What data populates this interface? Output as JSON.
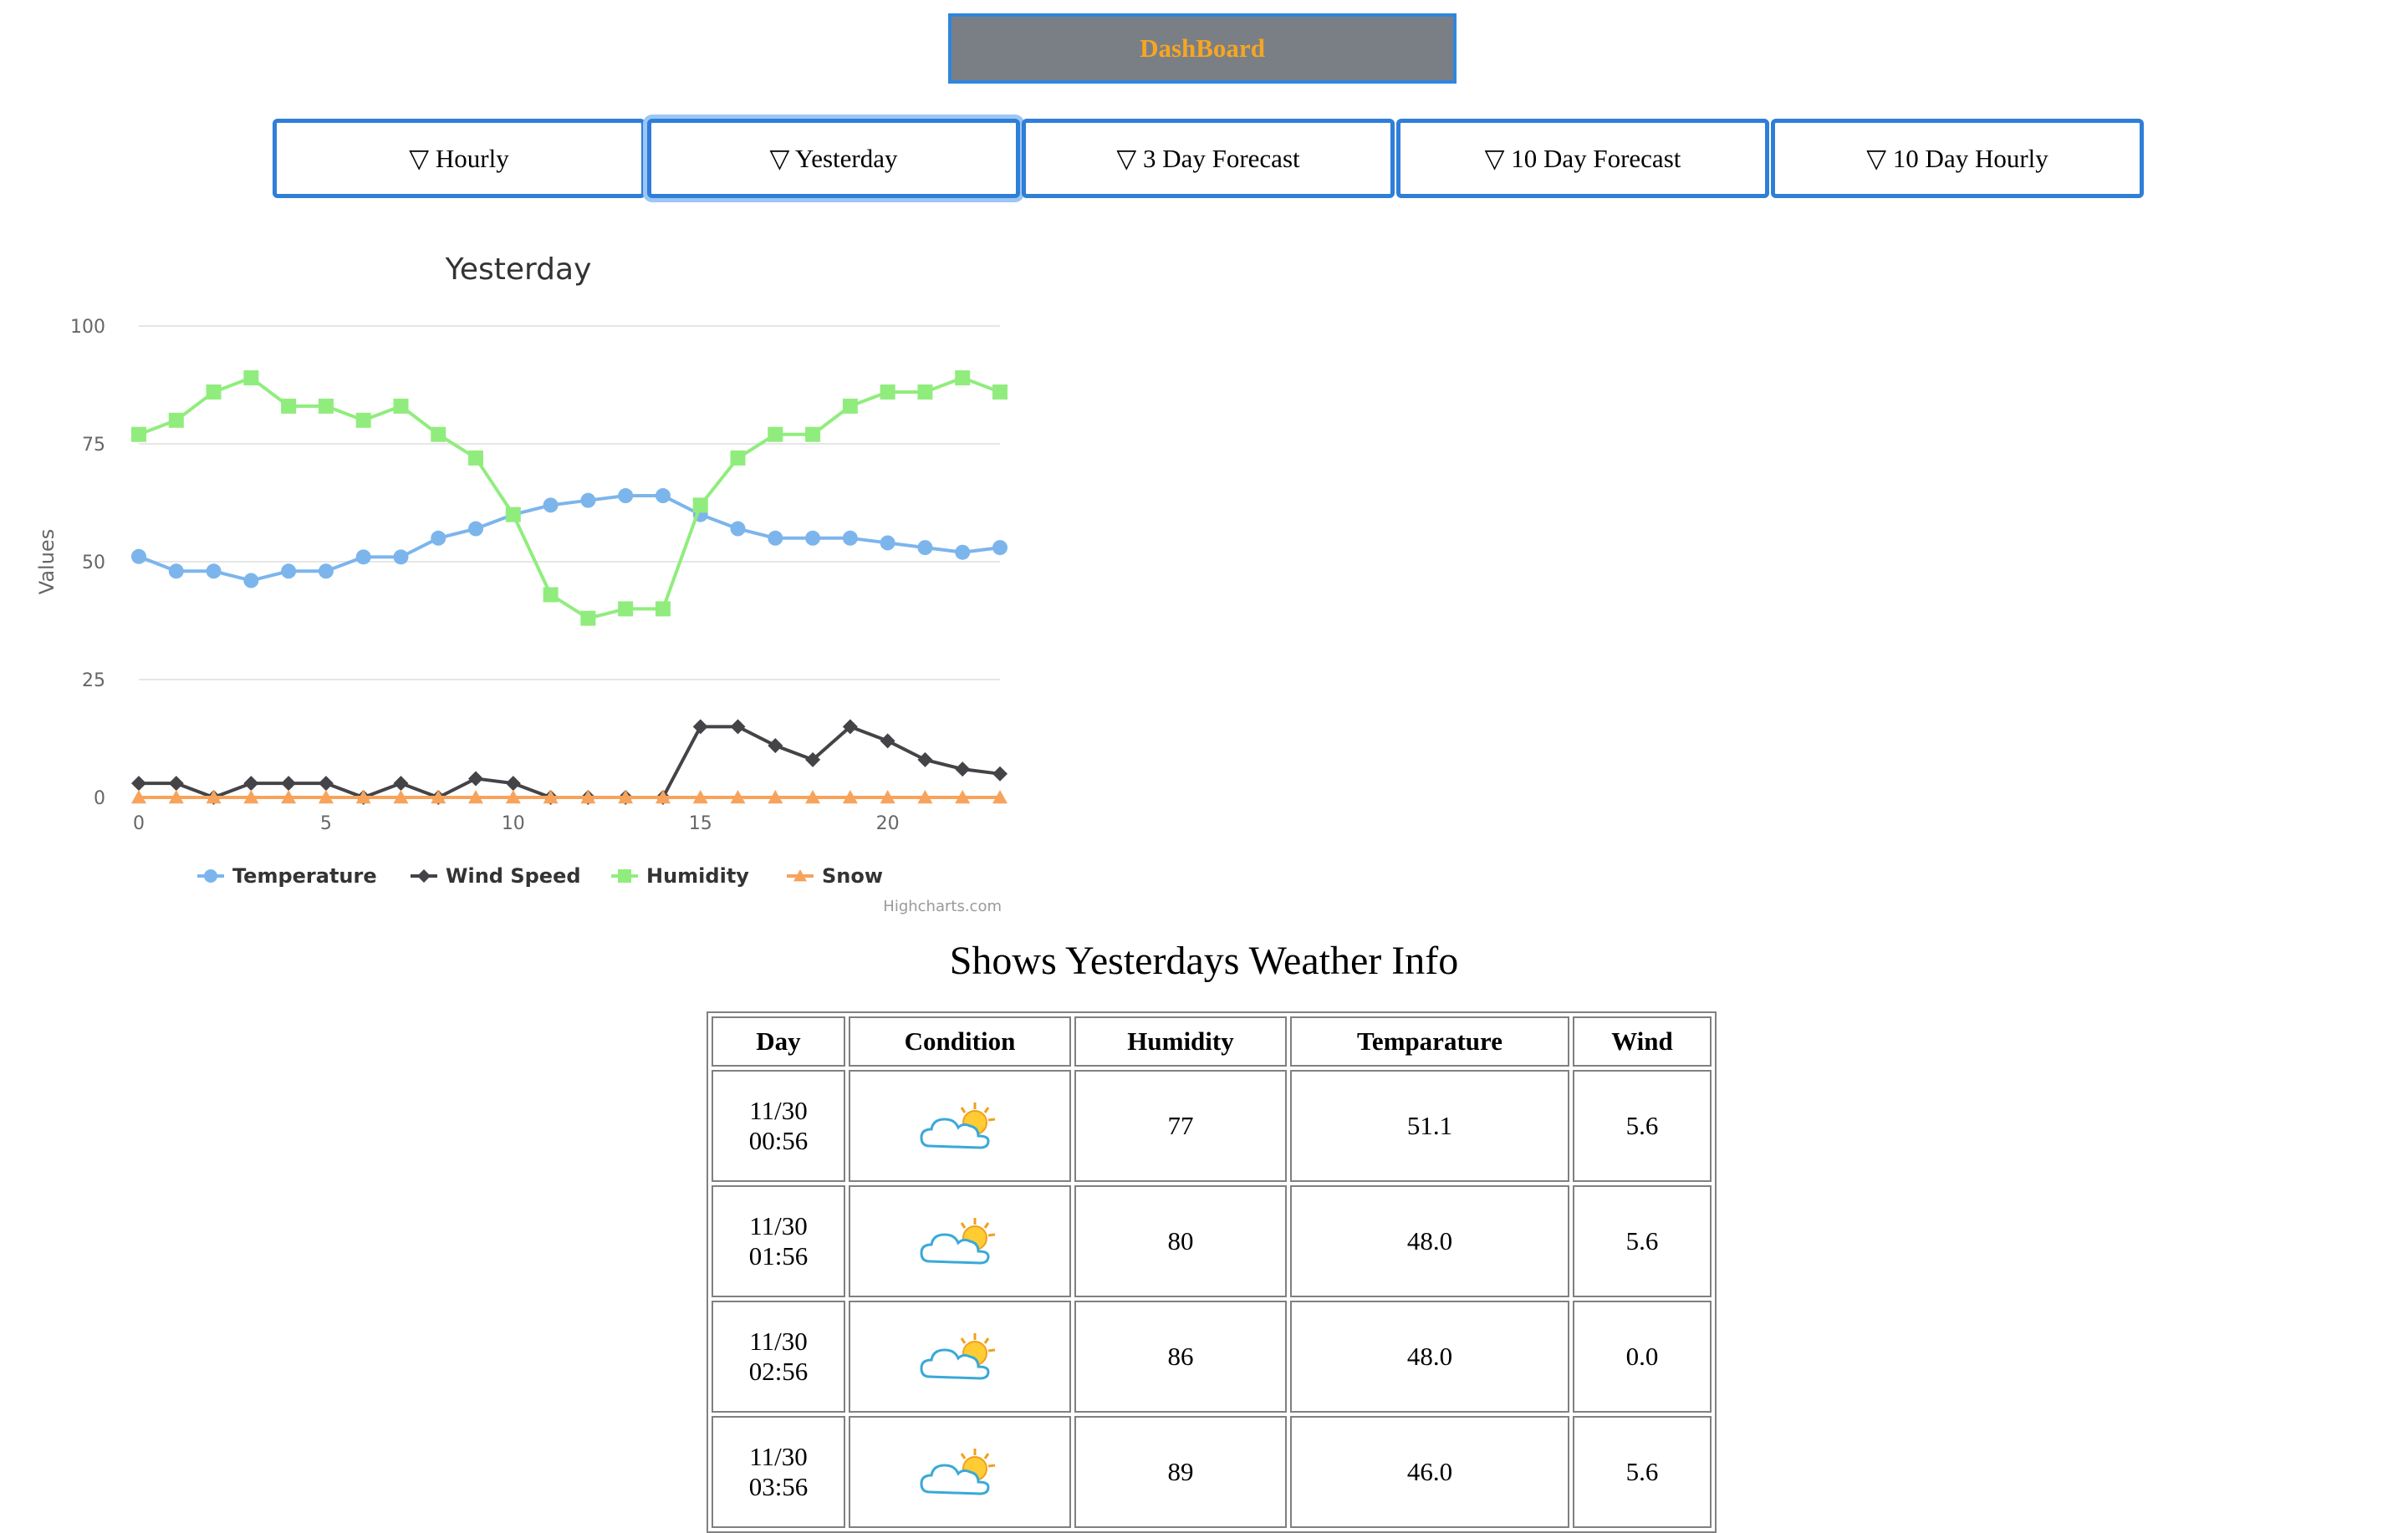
{
  "header": {
    "title": "DashBoard"
  },
  "tabs": [
    {
      "label": "▽ Hourly"
    },
    {
      "label": "▽ Yesterday"
    },
    {
      "label": "▽ 3 Day Forecast"
    },
    {
      "label": "▽ 10 Day Forecast"
    },
    {
      "label": "▽ 10 Day Hourly"
    }
  ],
  "active_tab": "Yesterday",
  "chart_data": {
    "type": "line",
    "title": "Yesterday",
    "ylabel": "Values",
    "xlabel": "",
    "ylim": [
      0,
      100
    ],
    "y_ticks": [
      0,
      25,
      50,
      75,
      100
    ],
    "x_ticks": [
      0,
      5,
      10,
      15,
      20
    ],
    "x": [
      0,
      1,
      2,
      3,
      4,
      5,
      6,
      7,
      8,
      9,
      10,
      11,
      12,
      13,
      14,
      15,
      16,
      17,
      18,
      19,
      20,
      21,
      22,
      23
    ],
    "series": [
      {
        "name": "Temperature",
        "color": "#7cb5ec",
        "marker": "circle",
        "values": [
          51.1,
          48,
          48,
          46,
          48,
          48,
          51,
          51,
          55,
          57,
          60,
          62,
          63,
          64,
          64,
          60,
          57,
          55,
          55,
          55,
          54,
          53,
          52,
          53
        ]
      },
      {
        "name": "Wind Speed",
        "color": "#434348",
        "marker": "diamond",
        "values": [
          3,
          3,
          0,
          3,
          3,
          3,
          0,
          3,
          0,
          4,
          3,
          0,
          0,
          0,
          0,
          15,
          15,
          11,
          8,
          15,
          12,
          8,
          6,
          5
        ]
      },
      {
        "name": "Humidity",
        "color": "#90ed7d",
        "marker": "square",
        "values": [
          77,
          80,
          86,
          89,
          83,
          83,
          80,
          83,
          77,
          72,
          60,
          43,
          38,
          40,
          40,
          62,
          72,
          77,
          77,
          83,
          86,
          86,
          89,
          86
        ]
      },
      {
        "name": "Snow",
        "color": "#f7a35c",
        "marker": "triangle",
        "values": [
          0,
          0,
          0,
          0,
          0,
          0,
          0,
          0,
          0,
          0,
          0,
          0,
          0,
          0,
          0,
          0,
          0,
          0,
          0,
          0,
          0,
          0,
          0,
          0
        ]
      }
    ],
    "legend_position": "bottom-center",
    "grid": true,
    "credit": "Highcharts.com"
  },
  "table": {
    "title": "Shows Yesterdays Weather Info",
    "headers": [
      "Day",
      "Condition",
      "Humidity",
      "Temparature",
      "Wind"
    ],
    "rows": [
      {
        "day": "11/30",
        "time": "00:56",
        "condition_icon": "partly-cloudy-icon",
        "humidity": "77",
        "temperature": "51.1",
        "wind": "5.6"
      },
      {
        "day": "11/30",
        "time": "01:56",
        "condition_icon": "partly-cloudy-icon",
        "humidity": "80",
        "temperature": "48.0",
        "wind": "5.6"
      },
      {
        "day": "11/30",
        "time": "02:56",
        "condition_icon": "partly-cloudy-icon",
        "humidity": "86",
        "temperature": "48.0",
        "wind": "0.0"
      },
      {
        "day": "11/30",
        "time": "03:56",
        "condition_icon": "partly-cloudy-icon",
        "humidity": "89",
        "temperature": "46.0",
        "wind": "5.6"
      }
    ]
  }
}
